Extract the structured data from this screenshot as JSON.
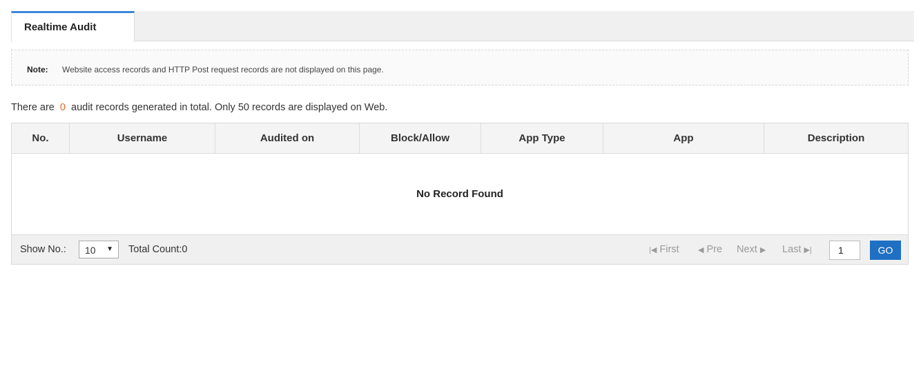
{
  "tabs": [
    {
      "label": "Realtime Audit"
    }
  ],
  "note": {
    "label": "Note:",
    "text": "Website access records and HTTP Post request records are not displayed on this page."
  },
  "summary": {
    "prefix": "There are",
    "count": "0",
    "suffix": "audit records generated in total. Only 50 records are displayed on Web."
  },
  "table": {
    "columns": [
      "No.",
      "Username",
      "Audited on",
      "Block/Allow",
      "App Type",
      "App",
      "Description"
    ],
    "empty_message": "No Record Found"
  },
  "pager": {
    "show_label": "Show No.:",
    "page_size": "10",
    "total_label": "Total Count:0",
    "first": "First",
    "prev": "Pre",
    "next": "Next",
    "last": "Last",
    "page_value": "1",
    "go_label": "GO"
  },
  "colors": {
    "accent": "#3a87d9",
    "count": "#e8632a",
    "go_button": "#1f6fc2"
  }
}
